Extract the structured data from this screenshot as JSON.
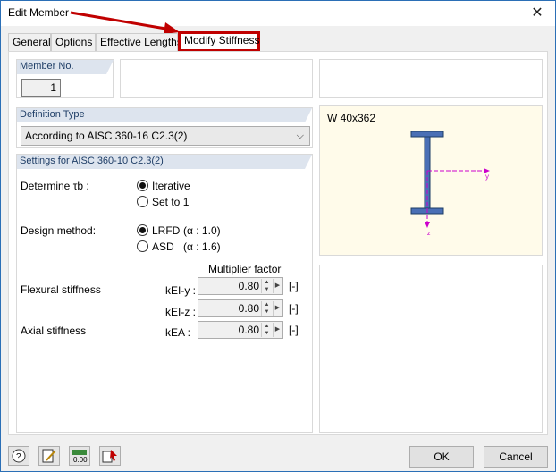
{
  "window": {
    "title": "Edit Member",
    "close_glyph": "✕"
  },
  "tabs": [
    {
      "label": "General"
    },
    {
      "label": "Options"
    },
    {
      "label": "Effective Lengths"
    },
    {
      "label": "Modify Stiffness"
    }
  ],
  "member": {
    "header": "Member No.",
    "number": "1"
  },
  "definition": {
    "header": "Definition Type",
    "value": "According to AISC 360-16 C2.3(2)"
  },
  "settings": {
    "header": "Settings for AISC 360-10 C2.3(2)",
    "determine_label": "Determine τb :",
    "radio_iterative": "Iterative",
    "radio_set_to_1": "Set to 1",
    "design_method_label": "Design method:",
    "radio_lrfd": "LRFD",
    "lrfd_alpha": "(α : 1.0)",
    "radio_asd": "ASD",
    "asd_alpha": "(α : 1.6)",
    "multiplier_header": "Multiplier factor",
    "flexural_label": "Flexural stiffness",
    "axial_label": "Axial stiffness",
    "k_ei_y_label": "kEI-y :",
    "k_ei_z_label": "kEI-z :",
    "k_ea_label": "kEA :",
    "k_ei_y_value": "0.80",
    "k_ei_z_value": "0.80",
    "k_ea_value": "0.80",
    "unit": "[-]"
  },
  "preview": {
    "section_name": "W 40x362",
    "axis_y": "y",
    "axis_z": "z"
  },
  "buttons": {
    "ok": "OK",
    "cancel": "Cancel"
  },
  "icons": [
    "help-icon",
    "edit-icon",
    "units-icon",
    "pointer-icon"
  ],
  "colors": {
    "accent_red": "#c00000",
    "group_header": "#dde4ee",
    "axis": "#cc00cc",
    "section_fill": "#4a6fb5"
  }
}
